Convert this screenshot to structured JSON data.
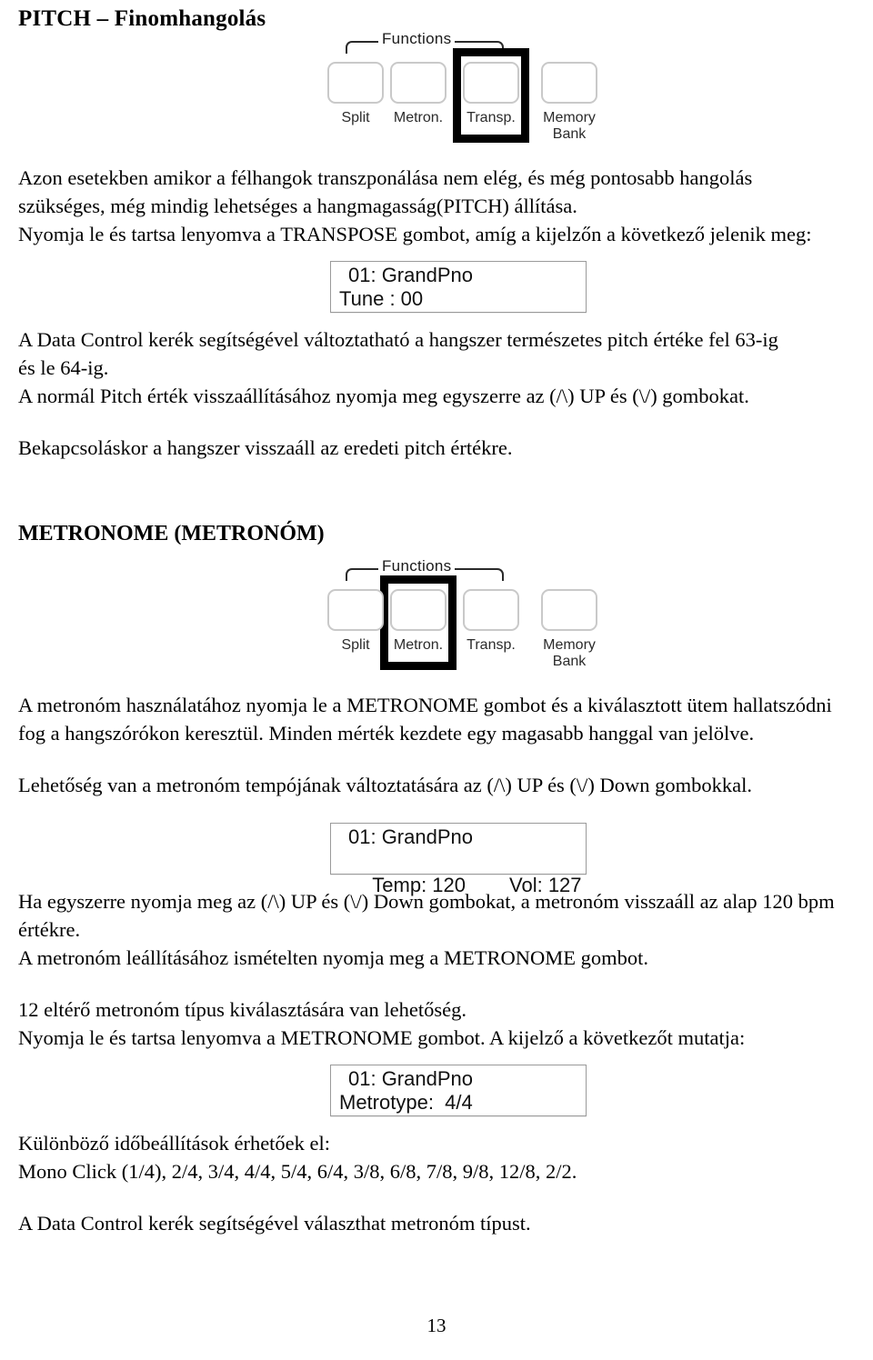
{
  "document": {
    "title": "PITCH – Finomhangolás",
    "page_number": "13"
  },
  "sections": [
    {
      "heading": "PITCH – Finomhangolás"
    },
    {
      "heading": "METRONOME (METRONÓM)"
    }
  ],
  "panel_pitch": {
    "group_label": "Functions",
    "keys": [
      {
        "label": "Split",
        "highlighted": false
      },
      {
        "label": "Metron.",
        "highlighted": false
      },
      {
        "label": "Transp.",
        "highlighted": true
      },
      {
        "label": "Memory",
        "label2": "Bank",
        "highlighted": false
      }
    ]
  },
  "panel_metronome": {
    "group_label": "Functions",
    "keys": [
      {
        "label": "Split",
        "highlighted": false
      },
      {
        "label": "Metron.",
        "highlighted": true
      },
      {
        "label": "Transp.",
        "highlighted": false
      },
      {
        "label": "Memory",
        "label2": "Bank",
        "highlighted": false
      }
    ]
  },
  "paragraphs": {
    "pitch_intro_l1": "Azon esetekben amikor a félhangok transzponálása nem elég, és még pontosabb hangolás",
    "pitch_intro_l2": "szükséges, még mindig lehetséges a hangmagasság(PITCH) állítása.",
    "pitch_intro_l3": "Nyomja le és tartsa lenyomva a TRANSPOSE gombot, amíg a kijelzőn a következő jelenik meg:",
    "pitch_after_l1": "A Data Control kerék segítségével változtatható a hangszer természetes pitch értéke fel 63-ig",
    "pitch_after_l2": "és le 64-ig.",
    "pitch_after_l3": "A normál Pitch érték visszaállításához nyomja meg egyszerre az (/\\) UP és (\\/) gombokat.",
    "pitch_after_l4": "Bekapcsoláskor a hangszer visszaáll az eredeti pitch értékre.",
    "metro_l1": "A metronóm használatához nyomja le a METRONOME gombot és a kiválasztott ütem hallatszódni",
    "metro_l2": "fog a hangszórókon keresztül. Minden mérték kezdete egy magasabb hanggal van jelölve.",
    "metro_l3": "Lehetőség van a metronóm tempójának változtatására az (/\\) UP és (\\/) Down gombokkal.",
    "metro_l4": "Ha egyszerre nyomja meg az (/\\) UP és (\\/) Down gombokat, a metronóm visszaáll az alap 120 bpm",
    "metro_l5": "értékre.",
    "metro_l6": "A metronóm leállításához ismételten nyomja meg a METRONOME gombot.",
    "metro_l7": "12 eltérő metronóm típus kiválasztására van lehetőség.",
    "metro_l8": "Nyomja le és tartsa lenyomva a METRONOME gombot. A kijelző a következőt mutatja:",
    "metro_l9": "Különböző időbeállítások érhetőek el:",
    "metro_l10": "Mono Click (1/4), 2/4, 3/4, 4/4, 5/4, 6/4, 3/8, 6/8, 7/8, 9/8, 12/8, 2/2.",
    "metro_l11": "A Data Control kerék segítségével választhat metronóm típust."
  },
  "displays": {
    "tune": {
      "line1": "01: GrandPno",
      "line2": "Tune : 00",
      "line2_right": ""
    },
    "tempo": {
      "line1": "01: GrandPno",
      "line2": "Temp: 120",
      "line2_right": "Vol: 127"
    },
    "metrotype": {
      "line1": "01: GrandPno",
      "line2": "Metrotype:  4/4",
      "line2_right": ""
    }
  },
  "colors": {
    "text": "#000000",
    "key_border": "#c9c9c9",
    "highlight": "#000000",
    "lcd_border": "#9a9a9a"
  }
}
